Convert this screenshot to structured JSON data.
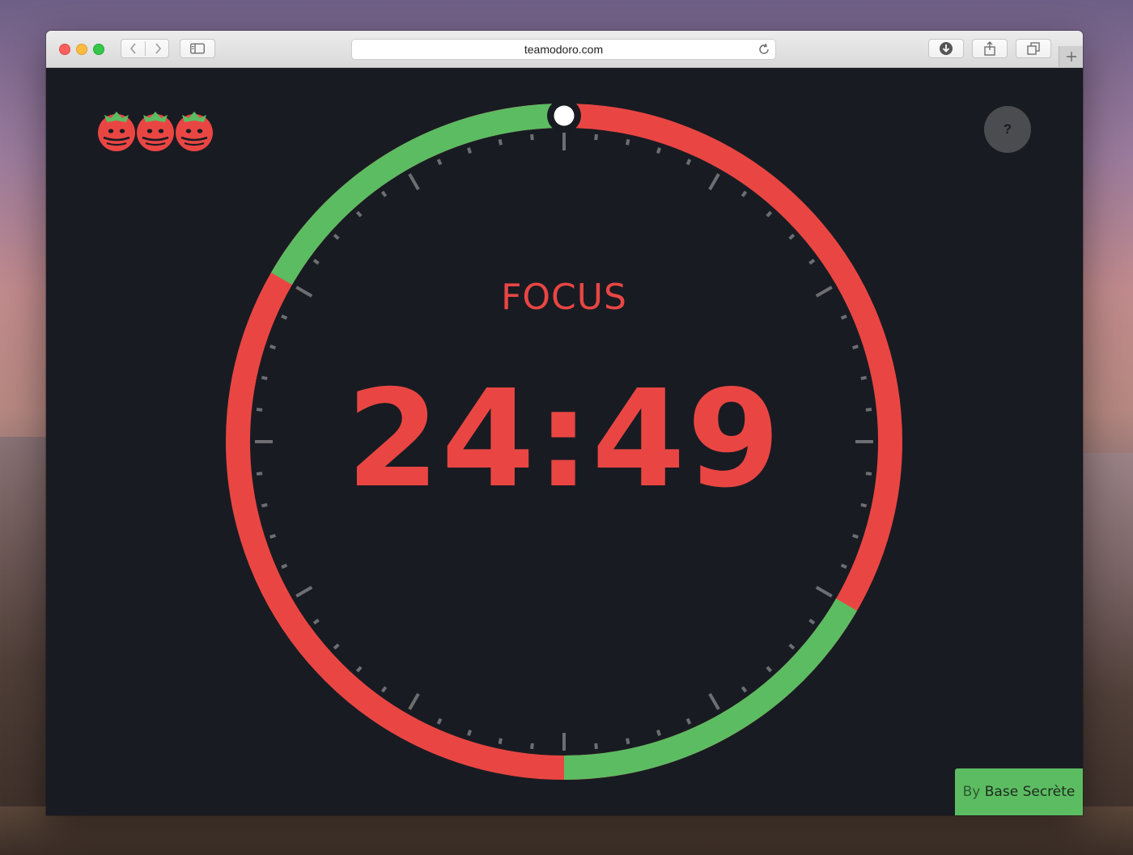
{
  "browser": {
    "url": "teamodoro.com"
  },
  "icons": {
    "traffic_lights": [
      "close-icon",
      "minimize-icon",
      "maximize-icon"
    ],
    "toolbar": [
      "chevron-left-icon",
      "chevron-right-icon",
      "sidebar-icon",
      "reload-icon",
      "download-icon",
      "share-icon",
      "tabs-icon",
      "plus-icon"
    ],
    "logo": "tomato-icon"
  },
  "app": {
    "help_label": "?",
    "mode": "FOCUS",
    "time": "24:49",
    "credit": {
      "by": "By",
      "name": "Base Secrète"
    }
  },
  "colors": {
    "background": "#191b22",
    "focus": "#e94643",
    "break": "#5cbc62",
    "tick": "#6d6e72",
    "help_button": "#4b4c50"
  },
  "timer": {
    "break_segments_minutes": [
      [
        50,
        60
      ],
      [
        20,
        30
      ]
    ],
    "progress_minutes": 0
  }
}
